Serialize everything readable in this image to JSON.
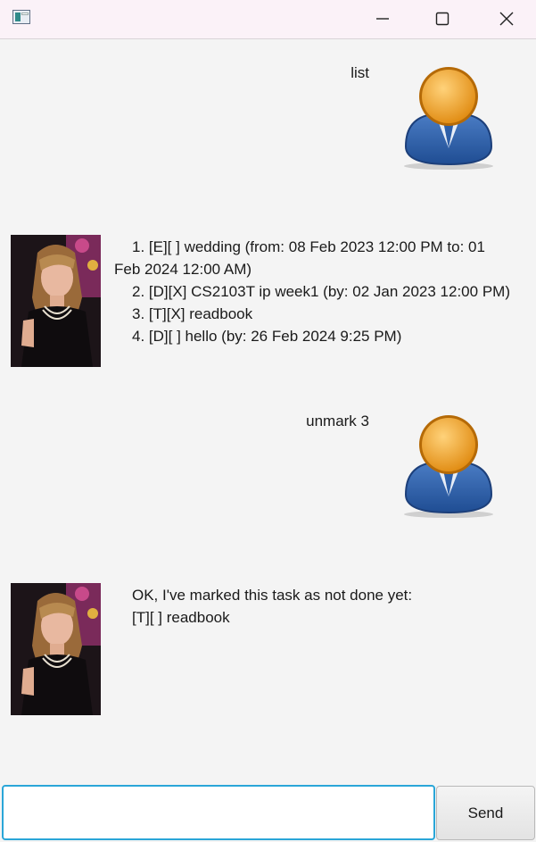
{
  "window": {
    "app_icon": "java-app-icon",
    "controls": [
      "minimize-icon",
      "maximize-icon",
      "close-icon"
    ]
  },
  "messages": [
    {
      "sender": "user",
      "text": "list",
      "avatar": "user-avatar-icon"
    },
    {
      "sender": "duke",
      "avatar": "duke-avatar",
      "lines": [
        "1. [E][ ] wedding  (from: 08 Feb 2023 12:00 PM to: 01",
        "Feb 2024 12:00 AM)",
        "2. [D][X] CS2103T ip week1  (by: 02 Jan 2023 12:00 PM)",
        "3. [T][X] readbook",
        "4. [D][ ] hello  (by: 26 Feb 2024 9:25 PM)"
      ]
    },
    {
      "sender": "user",
      "text": "unmark 3",
      "avatar": "user-avatar-icon"
    },
    {
      "sender": "duke",
      "avatar": "duke-avatar",
      "lines": [
        "OK, I've marked this task as not done yet:",
        "[T][ ] readbook"
      ]
    }
  ],
  "input": {
    "value": "",
    "placeholder": ""
  },
  "send_button": {
    "label": "Send"
  },
  "colors": {
    "background": "#f4f4f4",
    "titlebar": "#fbf2f8",
    "input_border": "#2aa6d8",
    "user_avatar_head": "#e8961e",
    "user_avatar_body": "#2d5fa8"
  }
}
